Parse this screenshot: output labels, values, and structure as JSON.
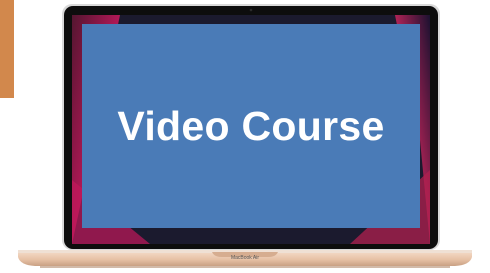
{
  "screen": {
    "title": "Video Course",
    "background_color": "#4a7bb7"
  },
  "device": {
    "brand_label": "MacBook Air",
    "body_color": "#e9c9b0",
    "bezel_color": "#0d0d0d"
  },
  "accent": {
    "color": "#d2884c"
  }
}
